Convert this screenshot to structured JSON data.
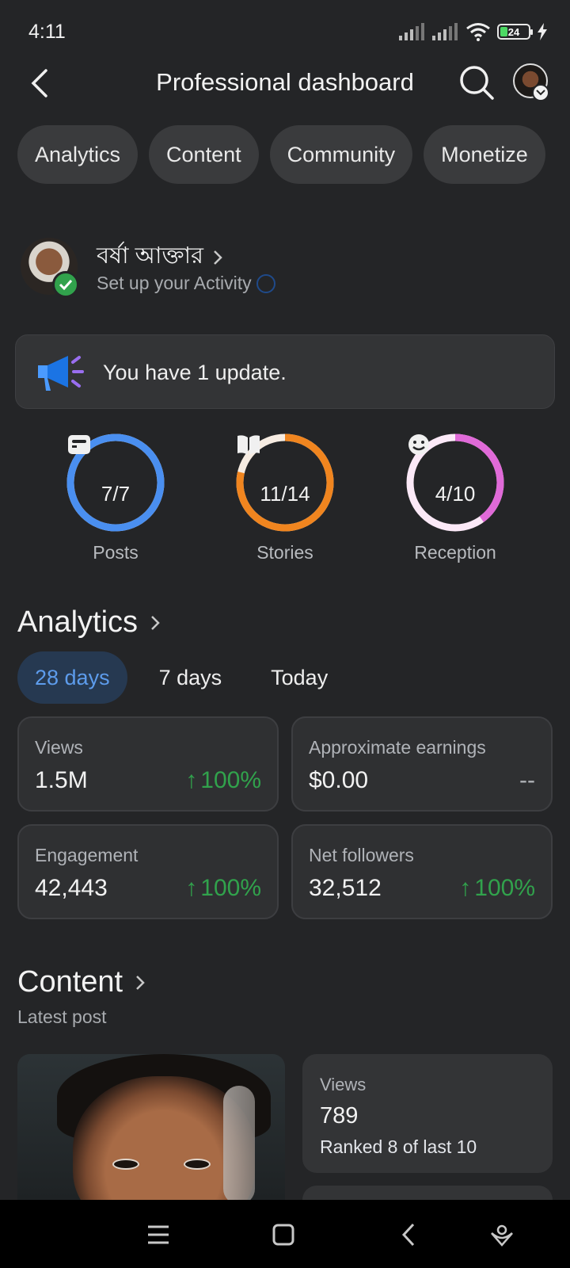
{
  "status_bar": {
    "time": "4:11",
    "battery": "24"
  },
  "header": {
    "title": "Professional dashboard"
  },
  "tabs": [
    {
      "label": "Analytics"
    },
    {
      "label": "Content"
    },
    {
      "label": "Community"
    },
    {
      "label": "Monetize"
    }
  ],
  "profile": {
    "name": "বর্ষা আক্তার",
    "subtitle": "Set up your Activity"
  },
  "update": {
    "text": "You have 1 update."
  },
  "progress": [
    {
      "label": "Posts",
      "value_text": "7/7",
      "done": 7,
      "total": 7,
      "color": "#4a8ff0",
      "track": "#f0e8e0",
      "icon": "post-icon"
    },
    {
      "label": "Stories",
      "value_text": "11/14",
      "done": 11,
      "total": 14,
      "color": "#f0851f",
      "track": "#f6ece2",
      "icon": "book-icon"
    },
    {
      "label": "Reception",
      "value_text": "4/10",
      "done": 4,
      "total": 10,
      "color": "#e06ad8",
      "track": "#fbe9f7",
      "icon": "smile-icon"
    }
  ],
  "analytics": {
    "title": "Analytics",
    "periods": [
      {
        "label": "28 days",
        "active": true
      },
      {
        "label": "7 days",
        "active": false
      },
      {
        "label": "Today",
        "active": false
      }
    ],
    "metrics": [
      {
        "label": "Views",
        "value": "1.5M",
        "change": "100%"
      },
      {
        "label": "Approximate earnings",
        "value": "$0.00",
        "change": "--"
      },
      {
        "label": "Engagement",
        "value": "42,443",
        "change": "100%"
      },
      {
        "label": "Net followers",
        "value": "32,512",
        "change": "100%"
      }
    ]
  },
  "content": {
    "title": "Content",
    "subtitle": "Latest post",
    "post_stats": {
      "label": "Views",
      "value": "789",
      "rank": "Ranked 8 of last 10"
    }
  },
  "colors": {
    "background": "#242527",
    "positive": "#31a24c",
    "accent": "#5d9cec"
  }
}
